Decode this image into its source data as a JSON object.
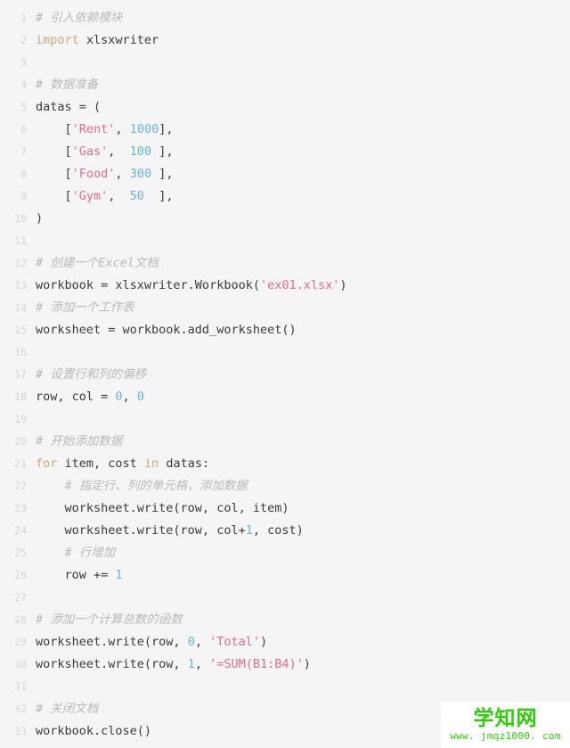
{
  "editor": {
    "language": "python",
    "background_color": "#f5f5f5",
    "line_number_color": "#d6d6d6",
    "total_lines": 33,
    "lines": [
      {
        "number": "1",
        "tokens": [
          {
            "t": "comment",
            "v": "# 引入依赖模块"
          }
        ]
      },
      {
        "number": "2",
        "tokens": [
          {
            "t": "keyword",
            "v": "import"
          },
          {
            "t": "plain",
            "v": " xlsxwriter"
          }
        ]
      },
      {
        "number": "3",
        "tokens": []
      },
      {
        "number": "4",
        "tokens": [
          {
            "t": "comment",
            "v": "# 数据准备"
          }
        ]
      },
      {
        "number": "5",
        "tokens": [
          {
            "t": "plain",
            "v": "datas = ("
          }
        ]
      },
      {
        "number": "6",
        "tokens": [
          {
            "t": "plain",
            "v": "    ["
          },
          {
            "t": "string",
            "v": "'Rent'"
          },
          {
            "t": "plain",
            "v": ", "
          },
          {
            "t": "number",
            "v": "1000"
          },
          {
            "t": "plain",
            "v": "],"
          }
        ]
      },
      {
        "number": "7",
        "tokens": [
          {
            "t": "plain",
            "v": "    ["
          },
          {
            "t": "string",
            "v": "'Gas'"
          },
          {
            "t": "plain",
            "v": ",  "
          },
          {
            "t": "number",
            "v": "100"
          },
          {
            "t": "plain",
            "v": " ],"
          }
        ]
      },
      {
        "number": "8",
        "tokens": [
          {
            "t": "plain",
            "v": "    ["
          },
          {
            "t": "string",
            "v": "'Food'"
          },
          {
            "t": "plain",
            "v": ", "
          },
          {
            "t": "number",
            "v": "300"
          },
          {
            "t": "plain",
            "v": " ],"
          }
        ]
      },
      {
        "number": "9",
        "tokens": [
          {
            "t": "plain",
            "v": "    ["
          },
          {
            "t": "string",
            "v": "'Gym'"
          },
          {
            "t": "plain",
            "v": ",  "
          },
          {
            "t": "number",
            "v": "50"
          },
          {
            "t": "plain",
            "v": "  ],"
          }
        ]
      },
      {
        "number": "10",
        "tokens": [
          {
            "t": "plain",
            "v": ")"
          }
        ]
      },
      {
        "number": "11",
        "tokens": []
      },
      {
        "number": "12",
        "tokens": [
          {
            "t": "comment",
            "v": "# 创建一个Excel文档"
          }
        ]
      },
      {
        "number": "13",
        "tokens": [
          {
            "t": "plain",
            "v": "workbook = xlsxwriter.Workbook("
          },
          {
            "t": "string",
            "v": "'ex01.xlsx'"
          },
          {
            "t": "plain",
            "v": ")"
          }
        ]
      },
      {
        "number": "14",
        "tokens": [
          {
            "t": "comment",
            "v": "# 添加一个工作表"
          }
        ]
      },
      {
        "number": "15",
        "tokens": [
          {
            "t": "plain",
            "v": "worksheet = workbook.add_worksheet()"
          }
        ]
      },
      {
        "number": "16",
        "tokens": []
      },
      {
        "number": "17",
        "tokens": [
          {
            "t": "comment",
            "v": "# 设置行和列的偏移"
          }
        ]
      },
      {
        "number": "18",
        "tokens": [
          {
            "t": "plain",
            "v": "row, col = "
          },
          {
            "t": "number",
            "v": "0"
          },
          {
            "t": "plain",
            "v": ", "
          },
          {
            "t": "number",
            "v": "0"
          }
        ]
      },
      {
        "number": "19",
        "tokens": []
      },
      {
        "number": "20",
        "tokens": [
          {
            "t": "comment",
            "v": "# 开始添加数据"
          }
        ]
      },
      {
        "number": "21",
        "tokens": [
          {
            "t": "keyword",
            "v": "for"
          },
          {
            "t": "plain",
            "v": " item, cost "
          },
          {
            "t": "keyword",
            "v": "in"
          },
          {
            "t": "plain",
            "v": " datas:"
          }
        ]
      },
      {
        "number": "22",
        "tokens": [
          {
            "t": "plain",
            "v": "    "
          },
          {
            "t": "comment",
            "v": "# 指定行、列的单元格，添加数据"
          }
        ]
      },
      {
        "number": "23",
        "tokens": [
          {
            "t": "plain",
            "v": "    worksheet.write(row, col, item)"
          }
        ]
      },
      {
        "number": "24",
        "tokens": [
          {
            "t": "plain",
            "v": "    worksheet.write(row, col+"
          },
          {
            "t": "number",
            "v": "1"
          },
          {
            "t": "plain",
            "v": ", cost)"
          }
        ]
      },
      {
        "number": "25",
        "tokens": [
          {
            "t": "plain",
            "v": "    "
          },
          {
            "t": "comment",
            "v": "# 行增加"
          }
        ]
      },
      {
        "number": "26",
        "tokens": [
          {
            "t": "plain",
            "v": "    row += "
          },
          {
            "t": "number",
            "v": "1"
          }
        ]
      },
      {
        "number": "27",
        "tokens": []
      },
      {
        "number": "28",
        "tokens": [
          {
            "t": "comment",
            "v": "# 添加一个计算总数的函数"
          }
        ]
      },
      {
        "number": "29",
        "tokens": [
          {
            "t": "plain",
            "v": "worksheet.write(row, "
          },
          {
            "t": "number",
            "v": "0"
          },
          {
            "t": "plain",
            "v": ", "
          },
          {
            "t": "string",
            "v": "'Total'"
          },
          {
            "t": "plain",
            "v": ")"
          }
        ]
      },
      {
        "number": "30",
        "tokens": [
          {
            "t": "plain",
            "v": "worksheet.write(row, "
          },
          {
            "t": "number",
            "v": "1"
          },
          {
            "t": "plain",
            "v": ", "
          },
          {
            "t": "string",
            "v": "'=SUM(B1:B4)'"
          },
          {
            "t": "plain",
            "v": ")"
          }
        ]
      },
      {
        "number": "31",
        "tokens": []
      },
      {
        "number": "32",
        "tokens": [
          {
            "t": "comment",
            "v": "# 关闭文档"
          }
        ]
      },
      {
        "number": "33",
        "tokens": [
          {
            "t": "plain",
            "v": "workbook.close()"
          }
        ]
      }
    ]
  },
  "watermark": {
    "title": "学知网",
    "url": "www. jmqz1000. com",
    "color": "#2ecc0a",
    "background": "#ffffff"
  }
}
